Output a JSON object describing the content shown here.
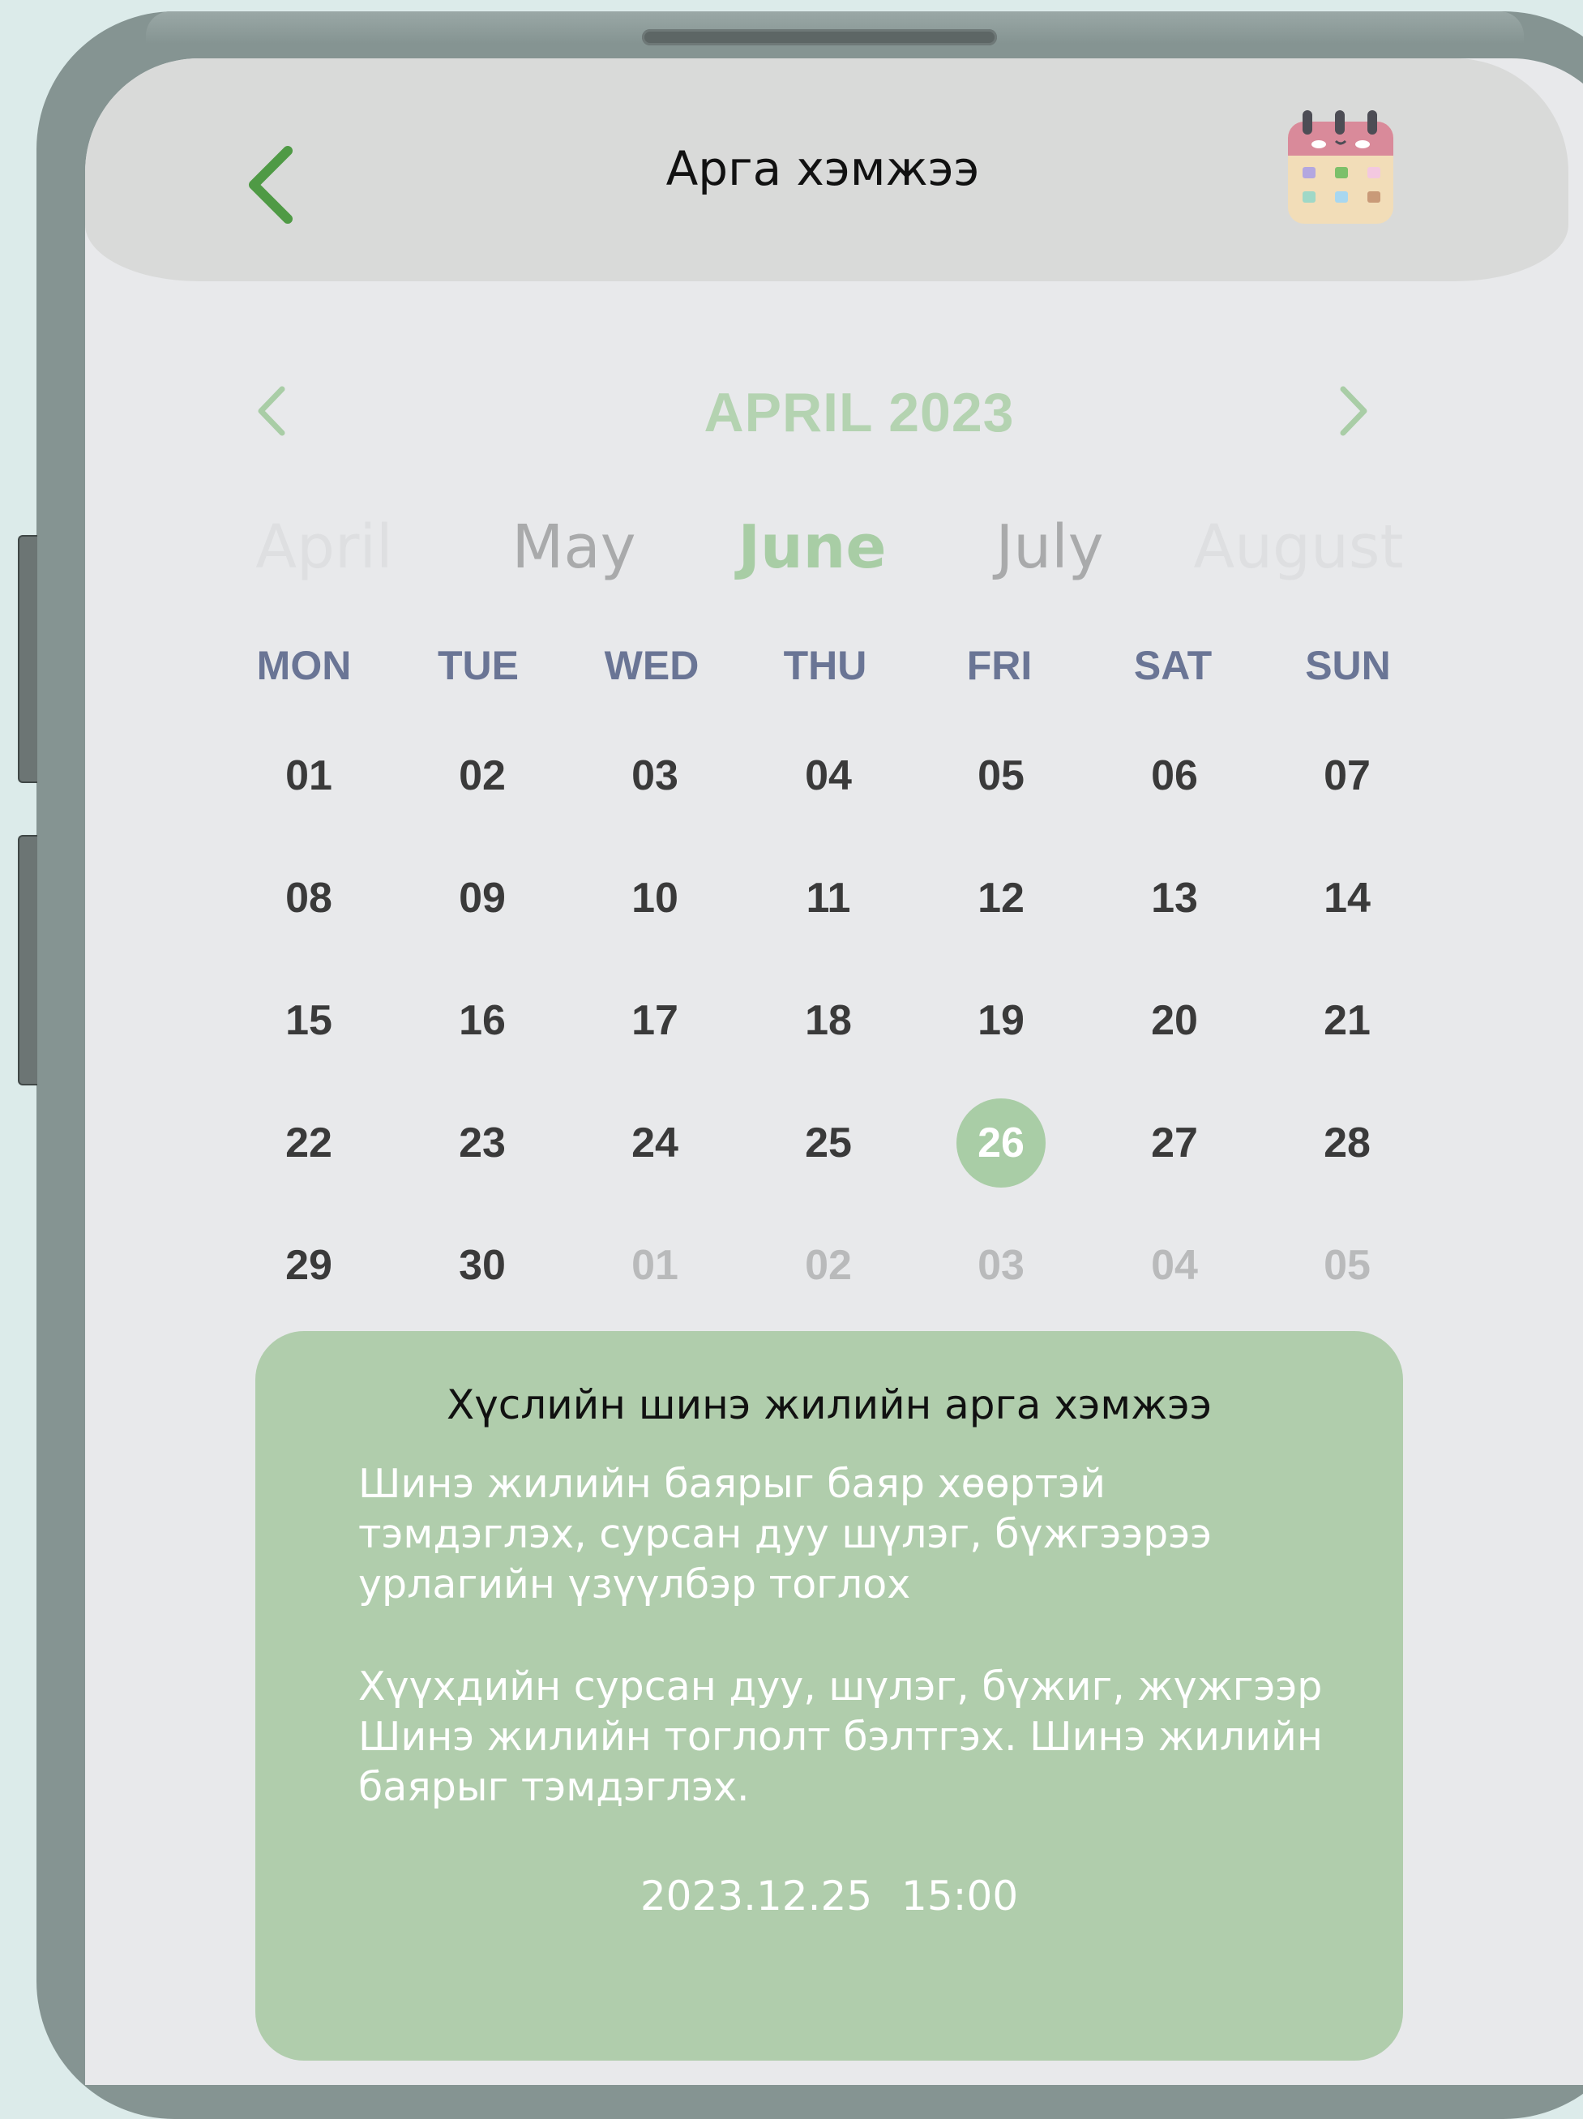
{
  "header": {
    "title": "Арга хэмжээ"
  },
  "calendar": {
    "month_title": "APRIL 2023",
    "month_strip": [
      "April",
      "May",
      "June",
      "July",
      "August"
    ],
    "selected_strip_month": "June",
    "weekdays": [
      "MON",
      "TUE",
      "WED",
      "THU",
      "FRI",
      "SAT",
      "SUN"
    ],
    "weeks": [
      [
        "01",
        "02",
        "03",
        "04",
        "05",
        "06",
        "07"
      ],
      [
        "08",
        "09",
        "10",
        "11",
        "12",
        "13",
        "14"
      ],
      [
        "15",
        "16",
        "17",
        "18",
        "19",
        "20",
        "21"
      ],
      [
        "22",
        "23",
        "24",
        "25",
        "26",
        "27",
        "28"
      ],
      [
        "29",
        "30",
        "01",
        "02",
        "03",
        "04",
        "05"
      ]
    ],
    "outside_month_days_last_week": [
      "01",
      "02",
      "03",
      "04",
      "05"
    ],
    "selected_day": "26"
  },
  "event": {
    "title": "Хүслийн шинэ жилийн арга хэмжээ",
    "paragraph_1": "Шинэ жилийн баярыг баяр хөөртэй тэмдэглэх, сурсан дуу шүлэг, бүжгээрээ урлагийн үзүүлбэр тоглох",
    "paragraph_2": "Хүүхдийн сурсан дуу, шүлэг, бүжиг, жүжгээр Шинэ жилийн тоглолт бэлтгэх. Шинэ жилийн баярыг тэмдэглэх.",
    "date": "2023.12.25",
    "time": "15:00"
  },
  "colors": {
    "accent_green": "#a9cda6",
    "back_arrow_green": "#4f9a45",
    "weekday_text": "#6a7595",
    "card_background": "#b0cdac",
    "screen_background": "#e8e9eb",
    "header_background": "#d9dad9"
  },
  "icons": {
    "back": "chevron-left-icon",
    "calendar": "calendar-icon",
    "prev_month": "chevron-left-icon",
    "next_month": "chevron-right-icon"
  }
}
